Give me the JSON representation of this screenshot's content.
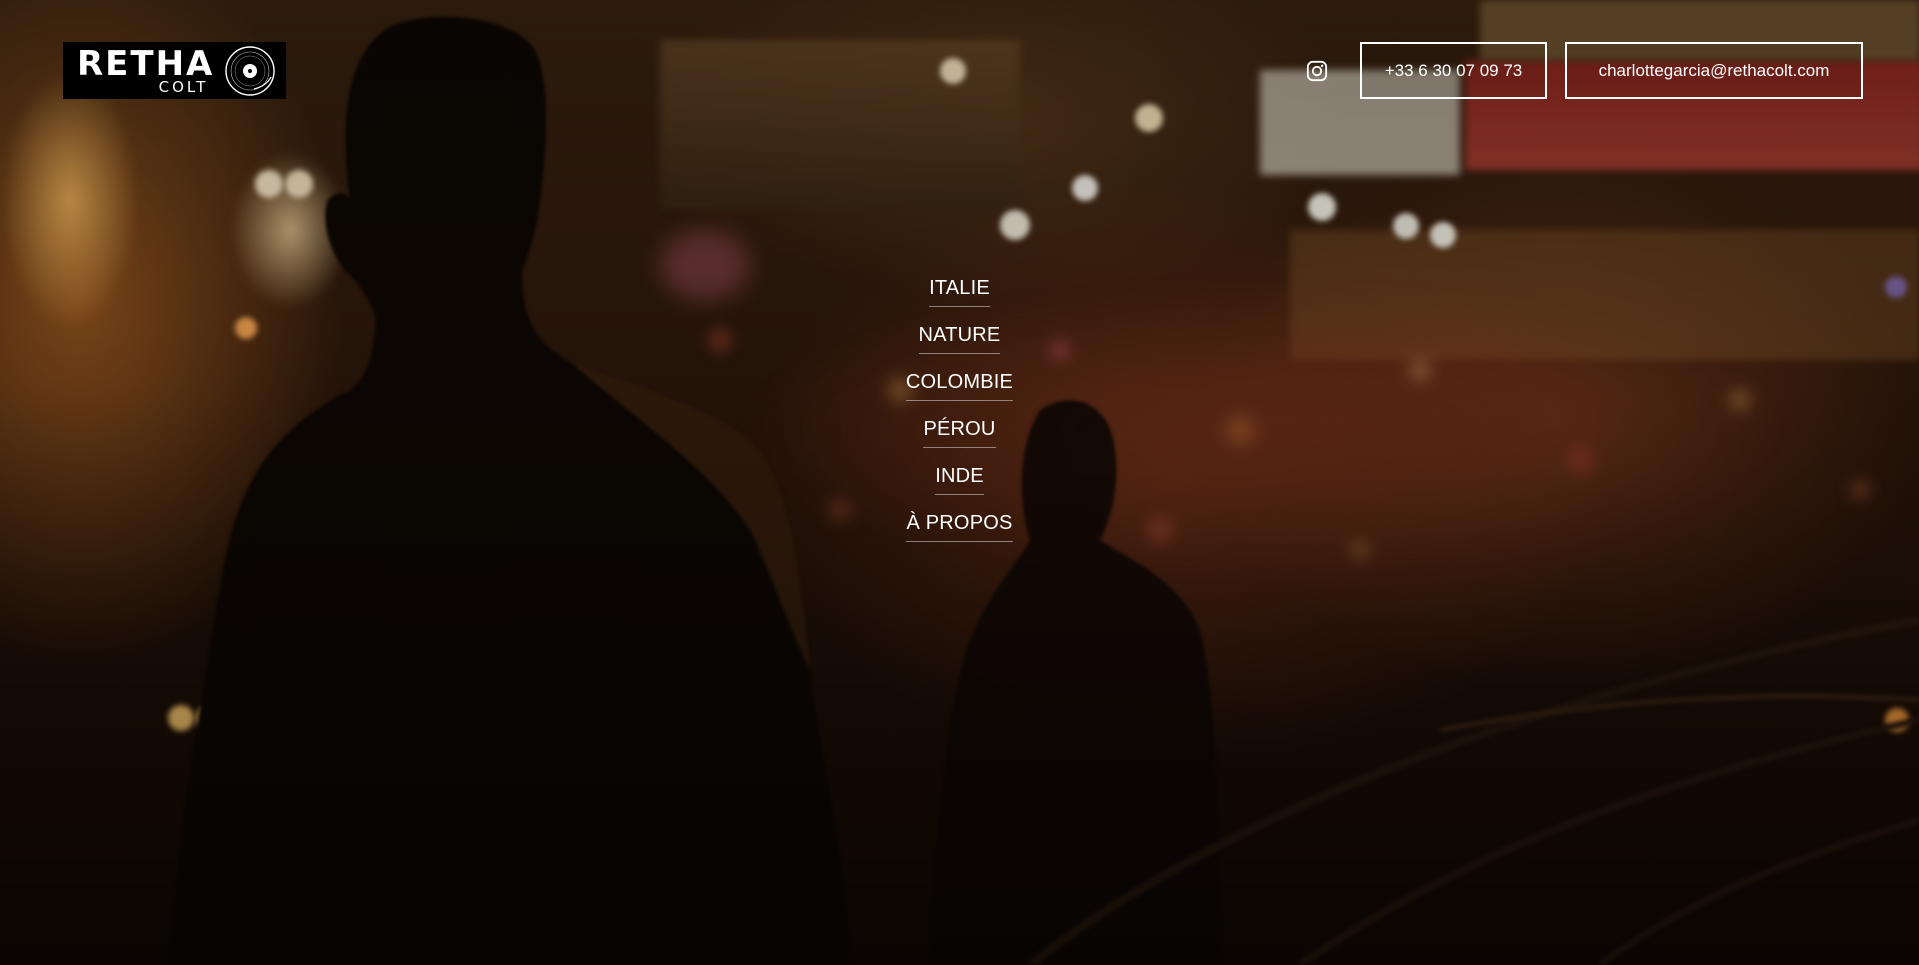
{
  "brand": {
    "name": "RETHA",
    "sub": "COLT",
    "logo_icon": "vinyl-disc-icon"
  },
  "contact": {
    "instagram_icon": "instagram-icon",
    "phone": "+33 6 30 07 09 73",
    "email": "charlottegarcia@rethacolt.com"
  },
  "menu": {
    "items": [
      {
        "label": "ITALIE"
      },
      {
        "label": "NATURE"
      },
      {
        "label": "COLOMBIE"
      },
      {
        "label": "PÉROU"
      },
      {
        "label": "INDE"
      },
      {
        "label": "À PROPOS"
      }
    ]
  },
  "colors": {
    "text": "#ffffff",
    "logo_bg": "#000000",
    "accent_warm": "#c8782d"
  }
}
